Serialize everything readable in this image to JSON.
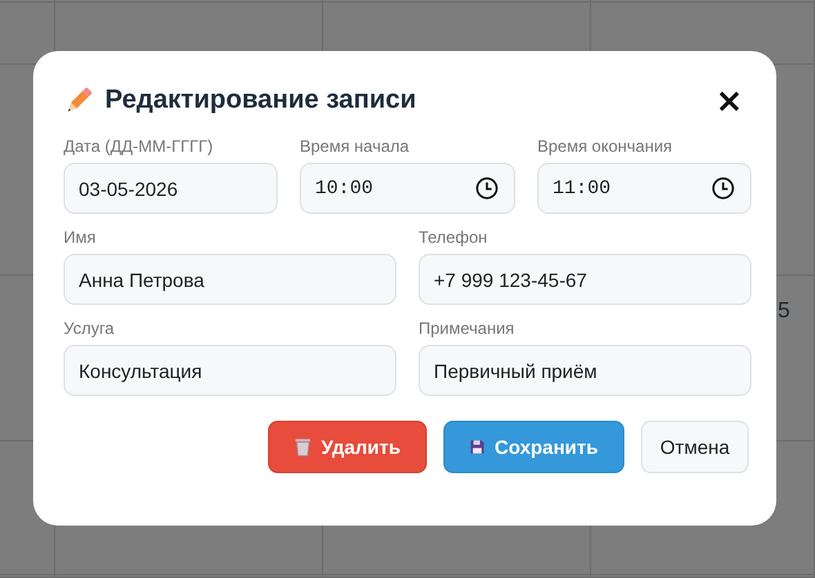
{
  "background": {
    "cell_text": "5"
  },
  "dialog": {
    "title": "Редактирование записи",
    "close": "×",
    "fields": [
      {
        "kind": "text",
        "label": "Дата (ДД-ММ-ГГГГ)",
        "value": "03-05-2026"
      },
      {
        "kind": "time",
        "label": "Время начала",
        "value": "10:00"
      },
      {
        "kind": "time",
        "label": "Время окончания",
        "value": "11:00"
      },
      {
        "kind": "text",
        "label": "Имя",
        "value": "Анна Петрова"
      },
      {
        "kind": "text",
        "label": "Телефон",
        "value": "+7 999 123-45-67"
      },
      {
        "kind": "text",
        "label": "Услуга",
        "value": "Консультация"
      },
      {
        "kind": "text",
        "label": "Примечания",
        "value": "Первичный приём"
      }
    ],
    "buttons": [
      {
        "kind": "delete",
        "label": "Удалить"
      },
      {
        "kind": "save",
        "label": "Сохранить"
      },
      {
        "kind": "cancel",
        "label": "Отмена"
      }
    ]
  }
}
